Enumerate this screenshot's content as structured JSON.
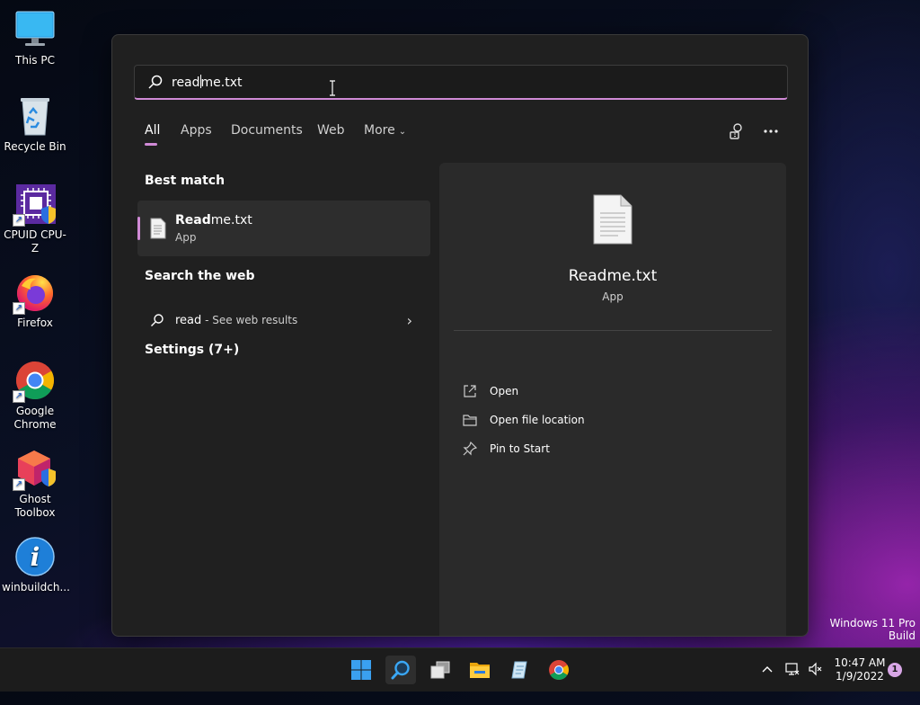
{
  "desktop": {
    "icons": [
      {
        "label": "This PC"
      },
      {
        "label": "Recycle Bin"
      },
      {
        "label": "CPUID CPU-Z"
      },
      {
        "label": "Firefox"
      },
      {
        "label": "Google Chrome"
      },
      {
        "label": "Ghost Toolbox"
      },
      {
        "label": "winbuildch..."
      }
    ],
    "watermark_line1": "Windows 11 Pro",
    "watermark_line2": "Build"
  },
  "search": {
    "query_before_caret": "read",
    "query_after_caret": "me.txt"
  },
  "tabs": [
    {
      "label": "All",
      "active": true
    },
    {
      "label": "Apps"
    },
    {
      "label": "Documents"
    },
    {
      "label": "Web"
    },
    {
      "label": "More"
    }
  ],
  "results": {
    "best_match_title": "Best match",
    "best_match": {
      "name_bold": "Read",
      "name_rest": "me.txt",
      "kind": "App"
    },
    "search_web_title": "Search the web",
    "web": {
      "query": "read",
      "suffix": " - See web results"
    },
    "settings_title": "Settings (7+)"
  },
  "preview": {
    "name": "Readme.txt",
    "kind": "App",
    "actions": [
      {
        "label": "Open",
        "icon": "open-external-icon"
      },
      {
        "label": "Open file location",
        "icon": "folder-icon"
      },
      {
        "label": "Pin to Start",
        "icon": "pin-icon"
      }
    ]
  },
  "taskbar": {
    "time": "10:47 AM",
    "date": "1/9/2022",
    "notifications": "1"
  },
  "colors": {
    "accent": "#d08ad6",
    "panel": "#202020",
    "preview": "#2a2a2a"
  }
}
